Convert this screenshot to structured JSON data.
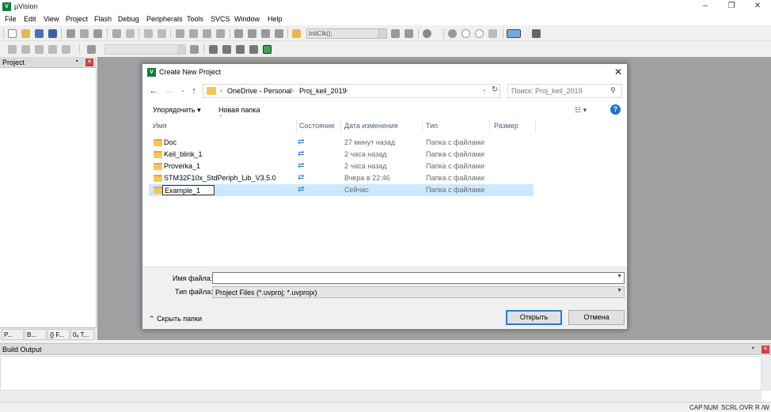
{
  "app": {
    "title": "µVision",
    "icon_letter": "V",
    "brand_color": "#0f7d3a"
  },
  "window_controls": {
    "minimize": "–",
    "maximize": "❐",
    "close": "✕"
  },
  "menu": [
    "File",
    "Edit",
    "View",
    "Project",
    "Flash",
    "Debug",
    "Peripherals",
    "Tools",
    "SVCS",
    "Window",
    "Help"
  ],
  "toolbar": {
    "target_combo_value": "InitClk();"
  },
  "project_pane": {
    "title": "Project",
    "tabs": [
      "P...",
      "B...",
      "{} F...",
      "0ₐ T..."
    ]
  },
  "build_output": {
    "title": "Build Output"
  },
  "statusbar": [
    "CAP",
    "NUM",
    "SCRL",
    "OVR",
    "R /W"
  ],
  "dialog": {
    "title": "Create New Project",
    "close": "✕",
    "breadcrumb": [
      "OneDrive - Personal",
      "Proj_keil_2019"
    ],
    "search_placeholder": "Поиск: Proj_keil_2019",
    "organize_label": "Упорядочить",
    "new_folder_label": "Новая папка",
    "columns": {
      "name": "Имя",
      "status": "Состояние",
      "date": "Дата изменения",
      "type": "Тип",
      "size": "Размер"
    },
    "files": [
      {
        "name": "Doc",
        "date": "27 минут назад",
        "type": "Папка с файлами"
      },
      {
        "name": "Keil_blink_1",
        "date": "2 часа назад",
        "type": "Папка с файлами"
      },
      {
        "name": "Proverka_1",
        "date": "2 часа назад",
        "type": "Папка с файлами"
      },
      {
        "name": "STM32F10x_StdPeriph_Lib_V3.5.0",
        "date": "Вчера в 22:46",
        "type": "Папка с файлами"
      },
      {
        "name": "Example_1",
        "date": "Сейчас",
        "type": "Папка с файлами",
        "renaming": true
      }
    ],
    "file_name_label": "Имя файла:",
    "file_name_value": "",
    "file_type_label": "Тип файла:",
    "file_type_value": "Project Files (*.uvproj; *.uvprojx)",
    "hide_folders_label": "Скрыть папки",
    "open_label": "Открыть",
    "cancel_label": "Отмена",
    "folder_color": "#f4c65b",
    "selection_color": "#cce8ff"
  }
}
